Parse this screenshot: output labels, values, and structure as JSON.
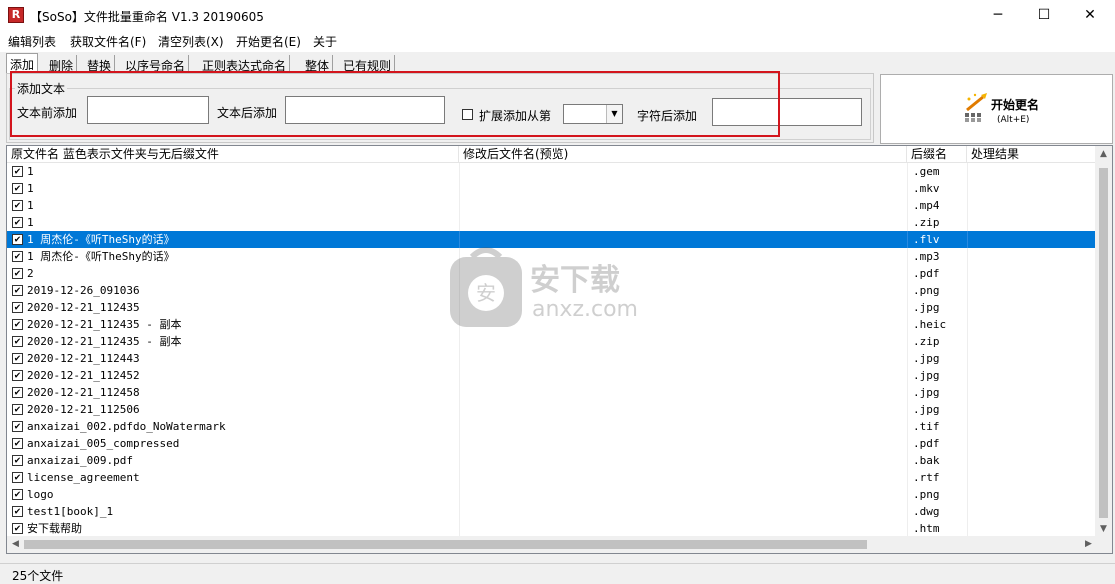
{
  "window": {
    "icon_letter": "R",
    "title": "【SoSo】文件批量重命名  V1.3 20190605",
    "minimize_glyph": "─",
    "maximize_glyph": "☐",
    "close_glyph": "✕"
  },
  "menu": {
    "items": [
      "编辑列表",
      "获取文件名(F)",
      "清空列表(X)",
      "开始更名(E)",
      "关于"
    ]
  },
  "tabs": {
    "items": [
      "添加",
      "删除",
      "替换",
      "以序号命名",
      "正则表达式命名",
      "整体",
      "已有规则"
    ],
    "active_index": 0
  },
  "add_text_panel": {
    "group_title": "添加文本",
    "before_label": "文本前添加",
    "before_value": "",
    "after_label": "文本后添加",
    "after_value": "",
    "extend_checkbox_label": "扩展添加从第",
    "extend_checked": false,
    "position_value": "",
    "after_char_label": "字符后添加",
    "after_char_value": ""
  },
  "start_button": {
    "label": "开始更名",
    "hotkey": "(Alt+E)",
    "icon": "rename-wand-icon"
  },
  "file_list": {
    "columns": [
      "原文件名 蓝色表示文件夹与无后缀文件",
      "修改后文件名(预览)",
      "后缀名",
      "处理结果"
    ],
    "rows": [
      {
        "name": "1",
        "preview": "",
        "ext": ".gem",
        "result": "",
        "checked": true,
        "selected": false
      },
      {
        "name": "1",
        "preview": "",
        "ext": ".mkv",
        "result": "",
        "checked": true,
        "selected": false
      },
      {
        "name": "1",
        "preview": "",
        "ext": ".mp4",
        "result": "",
        "checked": true,
        "selected": false
      },
      {
        "name": "1",
        "preview": "",
        "ext": ".zip",
        "result": "",
        "checked": true,
        "selected": false
      },
      {
        "name": "1 周杰伦-《听TheShy的话》",
        "preview": "",
        "ext": ".flv",
        "result": "",
        "checked": true,
        "selected": true
      },
      {
        "name": "1 周杰伦-《听TheShy的话》",
        "preview": "",
        "ext": ".mp3",
        "result": "",
        "checked": true,
        "selected": false
      },
      {
        "name": "2",
        "preview": "",
        "ext": ".pdf",
        "result": "",
        "checked": true,
        "selected": false
      },
      {
        "name": "2019-12-26_091036",
        "preview": "",
        "ext": ".png",
        "result": "",
        "checked": true,
        "selected": false
      },
      {
        "name": "2020-12-21_112435",
        "preview": "",
        "ext": ".jpg",
        "result": "",
        "checked": true,
        "selected": false
      },
      {
        "name": "2020-12-21_112435 - 副本",
        "preview": "",
        "ext": ".heic",
        "result": "",
        "checked": true,
        "selected": false
      },
      {
        "name": "2020-12-21_112435 - 副本",
        "preview": "",
        "ext": ".zip",
        "result": "",
        "checked": true,
        "selected": false
      },
      {
        "name": "2020-12-21_112443",
        "preview": "",
        "ext": ".jpg",
        "result": "",
        "checked": true,
        "selected": false
      },
      {
        "name": "2020-12-21_112452",
        "preview": "",
        "ext": ".jpg",
        "result": "",
        "checked": true,
        "selected": false
      },
      {
        "name": "2020-12-21_112458",
        "preview": "",
        "ext": ".jpg",
        "result": "",
        "checked": true,
        "selected": false
      },
      {
        "name": "2020-12-21_112506",
        "preview": "",
        "ext": ".jpg",
        "result": "",
        "checked": true,
        "selected": false
      },
      {
        "name": "anxaizai_002.pdfdo_NoWatermark",
        "preview": "",
        "ext": ".tif",
        "result": "",
        "checked": true,
        "selected": false
      },
      {
        "name": "anxaizai_005_compressed",
        "preview": "",
        "ext": ".pdf",
        "result": "",
        "checked": true,
        "selected": false
      },
      {
        "name": "anxaizai_009.pdf",
        "preview": "",
        "ext": ".bak",
        "result": "",
        "checked": true,
        "selected": false
      },
      {
        "name": "license_agreement",
        "preview": "",
        "ext": ".rtf",
        "result": "",
        "checked": true,
        "selected": false
      },
      {
        "name": "logo",
        "preview": "",
        "ext": ".png",
        "result": "",
        "checked": true,
        "selected": false
      },
      {
        "name": "test1[book]_1",
        "preview": "",
        "ext": ".dwg",
        "result": "",
        "checked": true,
        "selected": false
      },
      {
        "name": "安下载帮助",
        "preview": "",
        "ext": ".htm",
        "result": "",
        "checked": true,
        "selected": false
      }
    ]
  },
  "watermark": {
    "brand": "安下载",
    "domain": "anxz.com"
  },
  "status": {
    "text": "25个文件"
  },
  "colors": {
    "selection": "#0078d7",
    "highlight_box": "#d3141c"
  }
}
